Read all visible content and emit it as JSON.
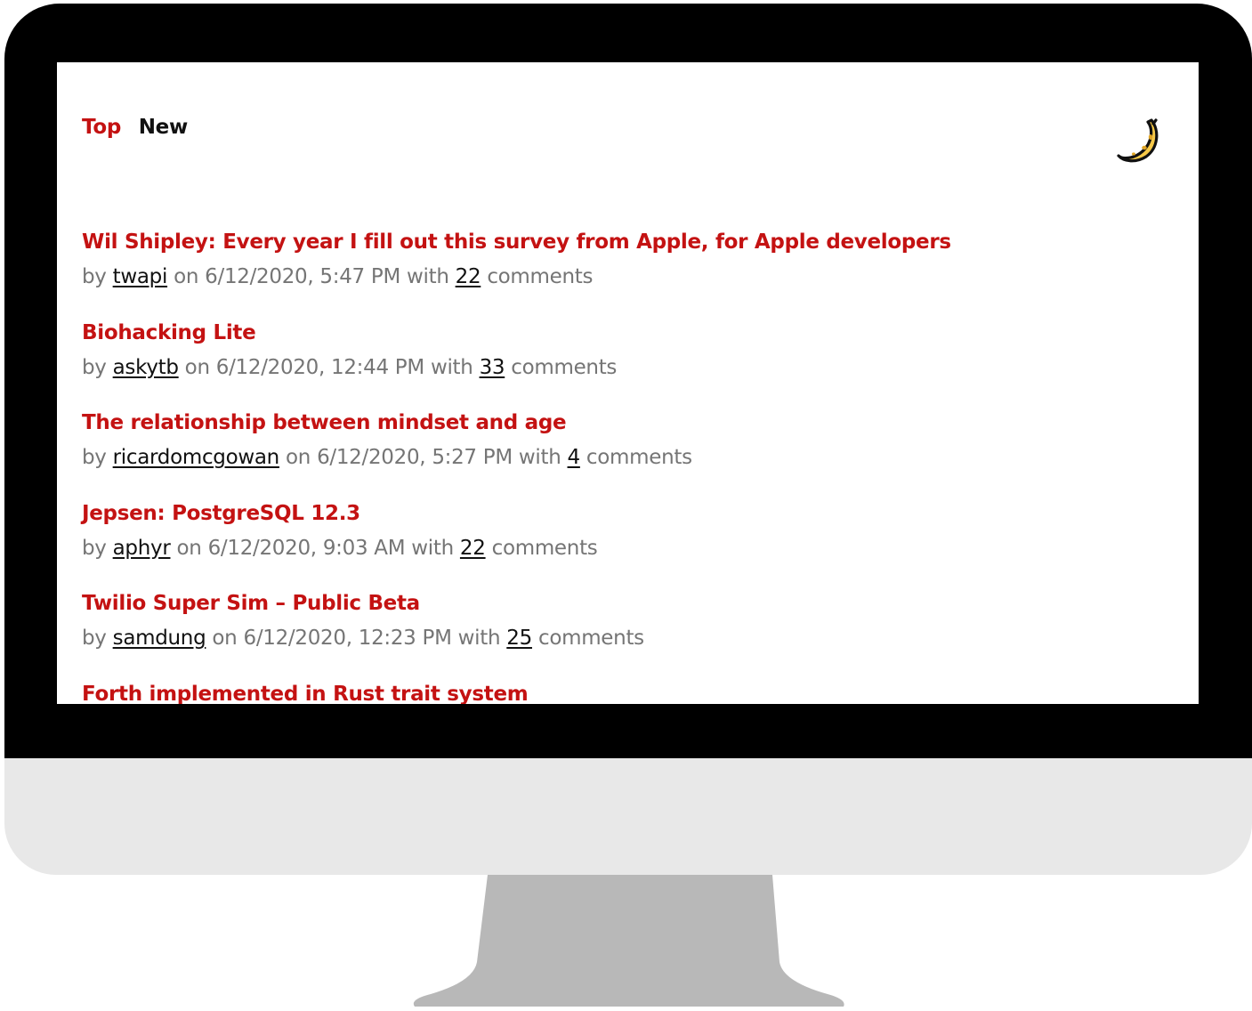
{
  "nav": {
    "tabs": [
      {
        "label": "Top",
        "active": true,
        "color": "#c41212"
      },
      {
        "label": "New",
        "active": false,
        "color": "#111111"
      }
    ],
    "theme_toggle_icon": "moon-icon"
  },
  "labels": {
    "by": "by",
    "on": "on",
    "with": "with",
    "comments": "comments"
  },
  "stories": [
    {
      "title": "Wil Shipley: Every year I fill out this survey from Apple, for Apple developers",
      "author": "twapi",
      "date": "6/12/2020, 5:47 PM",
      "comments": "22"
    },
    {
      "title": "Biohacking Lite",
      "author": "askytb",
      "date": "6/12/2020, 12:44 PM",
      "comments": "33"
    },
    {
      "title": "The relationship between mindset and age",
      "author": "ricardomcgowan",
      "date": "6/12/2020, 5:27 PM",
      "comments": "4"
    },
    {
      "title": "Jepsen: PostgreSQL 12.3",
      "author": "aphyr",
      "date": "6/12/2020, 9:03 AM",
      "comments": "22"
    },
    {
      "title": "Twilio Super Sim – Public Beta",
      "author": "samdung",
      "date": "6/12/2020, 12:23 PM",
      "comments": "25"
    },
    {
      "title": "Forth implemented in Rust trait system",
      "author": "",
      "date": "",
      "comments": ""
    }
  ],
  "colors": {
    "accent": "#c41212",
    "text": "#111111",
    "meta": "#757575",
    "bezel": "#000000",
    "chin": "#e8e8e8",
    "stand": "#b8b8b8",
    "moon": "#f7c948"
  }
}
